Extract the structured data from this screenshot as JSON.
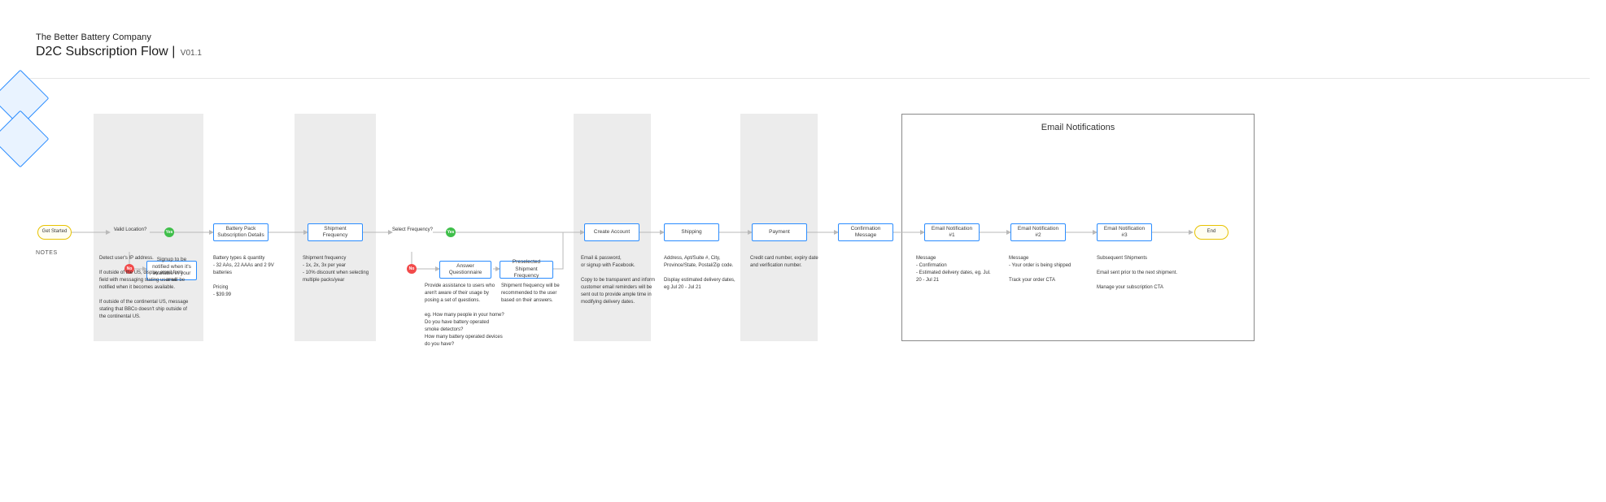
{
  "header": {
    "company": "The Better Battery Company",
    "title": "D2C Subscription Flow",
    "version": "V01.1"
  },
  "sidebar": {
    "notes_label": "NOTES"
  },
  "group": {
    "email": "Email Notifications"
  },
  "nodes": {
    "start": "Get Started",
    "end": "End",
    "valid_location": "Valid\nLocation?",
    "select_frequency": "Select\nFrequency?",
    "signup_notify": "Signup to be notified when it's available in your area",
    "battery_pack": "Battery Pack Subscription Details",
    "shipment_frequency": "Shipment Frequency",
    "answer_q": "Answer Questionnaire",
    "preselected_freq": "Preselected Shipment Frequency",
    "create_account": "Create Account",
    "shipping": "Shipping",
    "payment": "Payment",
    "confirmation": "Confirmation Message",
    "email1": "Email Notification #1",
    "email2": "Email Notification #2",
    "email3": "Email Notification #3"
  },
  "yesno": {
    "yes": "Yes",
    "no": "No"
  },
  "notes": {
    "n_location": "Detect user's IP address.\n\nIf outside of the US, display email form field with messaging stating user will be notified when it becomes available.\n\nIf outside of the continental US, message stating that BBCo doesn't ship outside of the continental US.",
    "n_battery": "Battery types & quantity\n- 32 AAs, 22 AAAs and 2 9V batteries\n\nPricing\n- $39.99",
    "n_shipfreq": "Shipment frequency\n- 1x, 2x, 3x per year\n- 10% discount when selecting multiple packs/year",
    "n_questionnaire": "Provide assistance to users who aren't aware of their usage by posing a set of questions.\n\neg. How many people in your home?\nDo you have battery operated smoke detectors?\nHow many battery operated devices do you have?",
    "n_preselected": "Shipment frequency will be recommended to the user based on their answers.",
    "n_account": "Email & password,\nor signup with Facebook.\n\nCopy to be transparent and inform customer email reminders will be sent out to provide ample time in modifying delivery dates.",
    "n_shipping": "Address, Apt/Suite #, City, Province/State, Postal/Zip code.\n\nDisplay estimated delivery dates, eg Jul 20 - Jul 21",
    "n_payment": "Credit card number, expiry date and verification number.",
    "n_email1": "Message\n- Confirmation\n- Estimated delivery dates, eg. Jul. 20 - Jul 21",
    "n_email2": "Message\n- Your order is being shipped\n\nTrack your order CTA",
    "n_email3": "Subsequent Shipments\n\nEmail sent prior to the next shipment.\n\nManage your subscription CTA"
  }
}
